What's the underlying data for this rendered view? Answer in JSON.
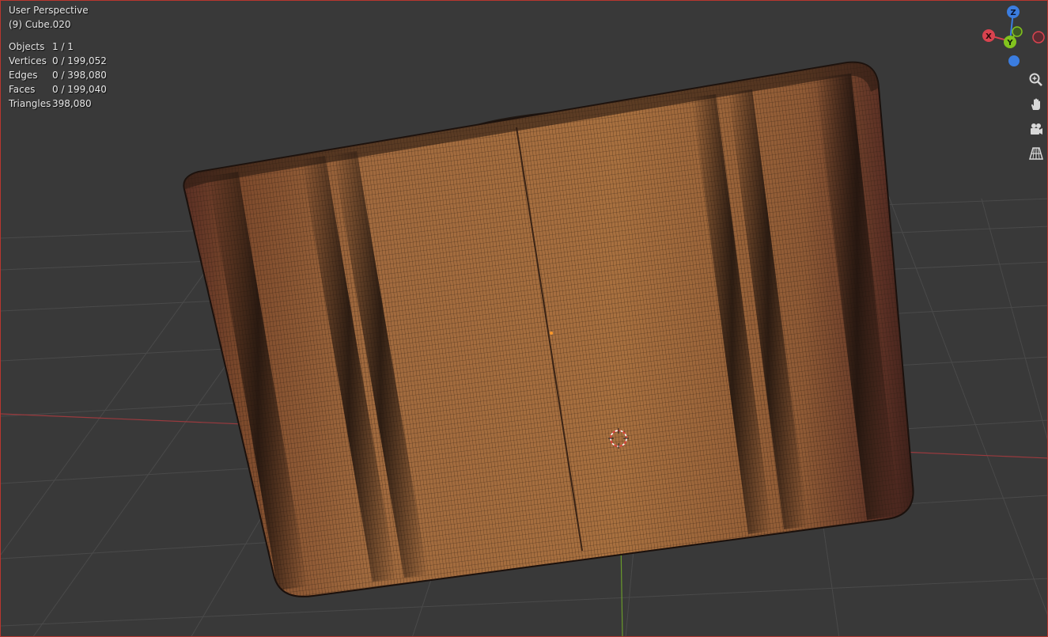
{
  "viewport": {
    "view_name": "User Perspective",
    "active_object": "(9) Cube.020"
  },
  "stats": {
    "objects": {
      "label": "Objects",
      "value": "1 / 1"
    },
    "vertices": {
      "label": "Vertices",
      "value": "0 / 199,052"
    },
    "edges": {
      "label": "Edges",
      "value": "0 / 398,080"
    },
    "faces": {
      "label": "Faces",
      "value": "0 / 199,040"
    },
    "triangles": {
      "label": "Triangles",
      "value": "398,080"
    }
  },
  "gizmo": {
    "x_label": "X",
    "y_label": "Y",
    "z_label": "Z",
    "x_color": "#d9434f",
    "y_color": "#82c31e",
    "z_color": "#3b7de0"
  },
  "nav_tools": {
    "icons": [
      "zoom-icon",
      "pan-hand-icon",
      "camera-icon",
      "perspective-grid-icon"
    ]
  },
  "colors": {
    "background": "#393939",
    "grid": "#4a4a4a",
    "x_axis": "#9a3a3e",
    "y_axis": "#6a9a2c",
    "mesh_fill": "#a0673a",
    "wire": "#2a1a10",
    "active_border": "#b8362f"
  }
}
